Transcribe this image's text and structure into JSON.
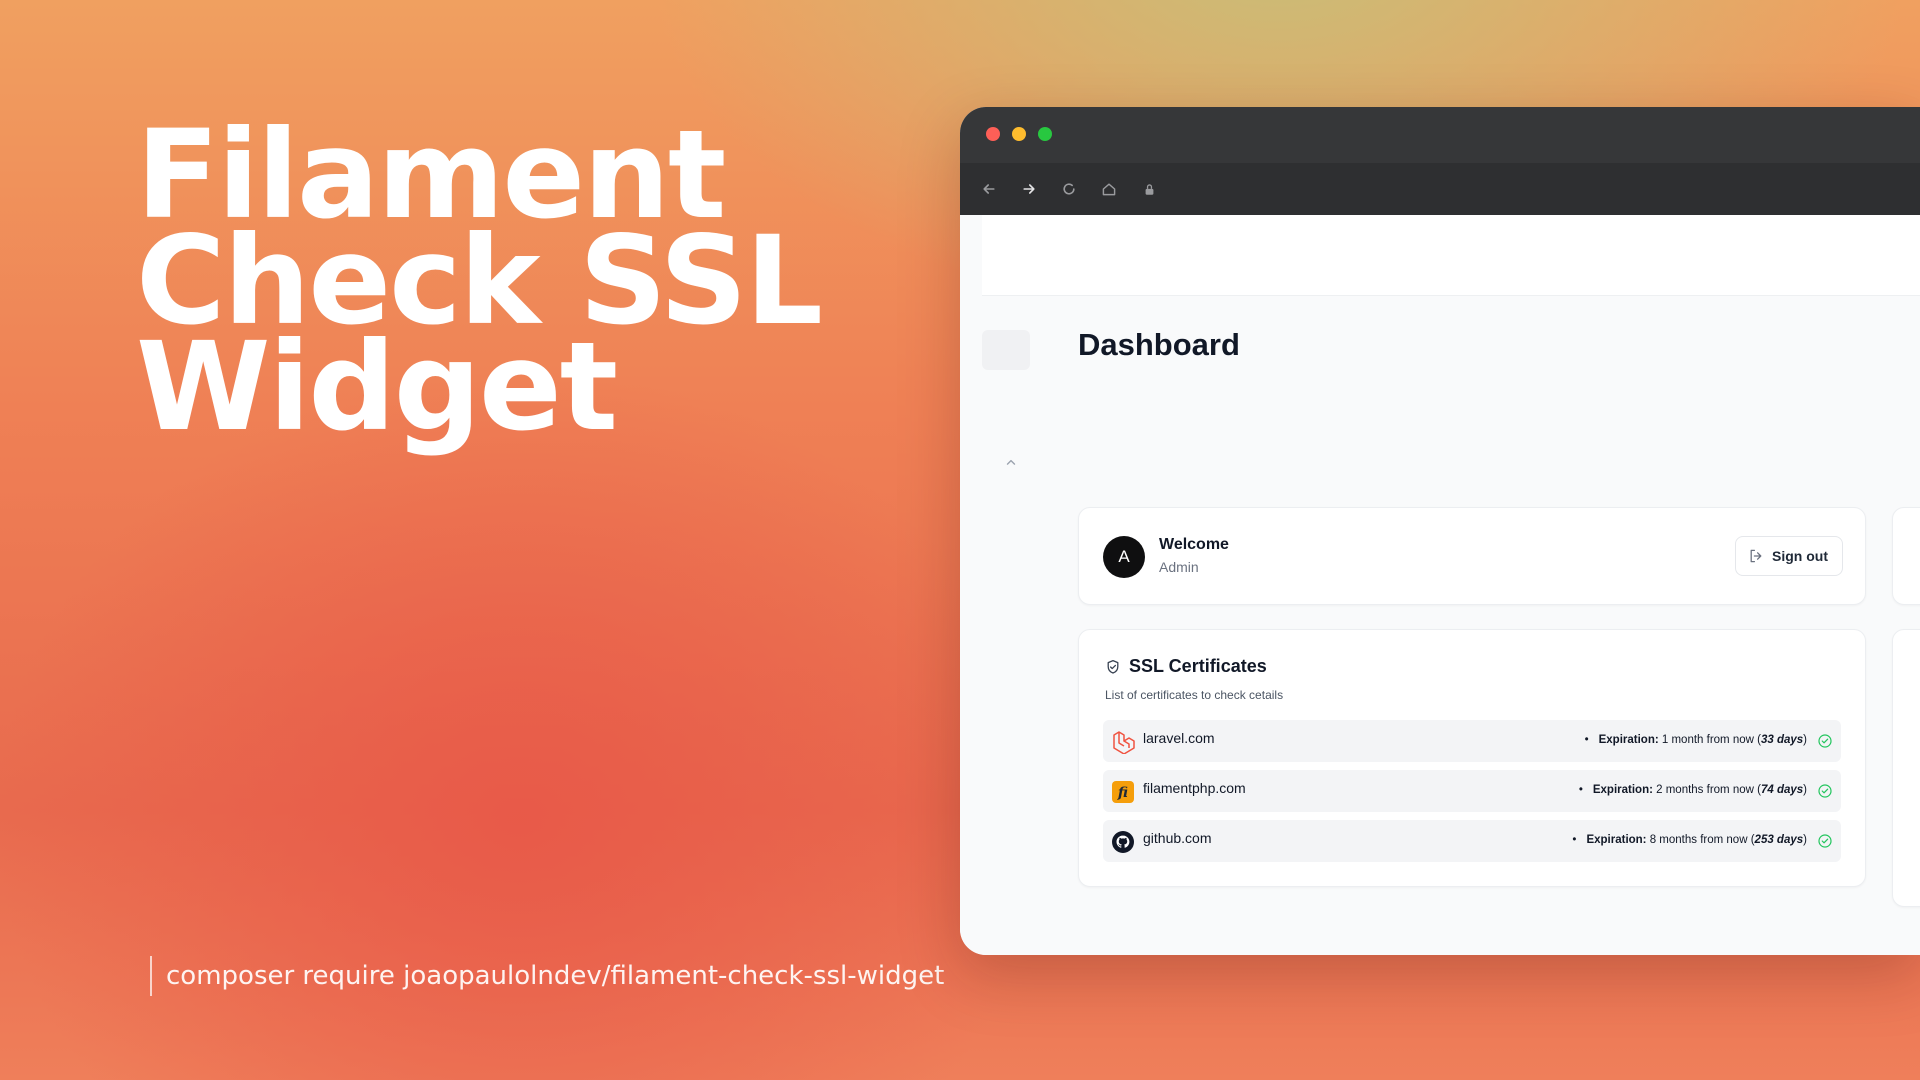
{
  "hero": {
    "title_lines": [
      "Filament",
      "Check SSL",
      "Widget"
    ],
    "command": "composer require joaopaulolndev/filament-check-ssl-widget"
  },
  "browser": {
    "icons": [
      "back-arrow-icon",
      "forward-arrow-icon",
      "reload-icon",
      "home-icon",
      "lock-icon"
    ]
  },
  "dashboard": {
    "title": "Dashboard",
    "welcome": {
      "avatar_initial": "A",
      "title": "Welcome",
      "role": "Admin",
      "signout_label": "Sign out"
    },
    "ssl": {
      "title": "SSL Certificates",
      "subtitle": "List of certificates to check cetails",
      "expiration_label": "Expiration:",
      "rows": [
        {
          "domain": "laravel.com",
          "relative": "1 month from now",
          "days": "33 days",
          "logo": "laravel-logo-icon",
          "status_color": "#22c55e"
        },
        {
          "domain": "filamentphp.com",
          "relative": "2 months from now",
          "days": "74 days",
          "logo": "filament-logo-icon",
          "status_color": "#22c55e"
        },
        {
          "domain": "github.com",
          "relative": "8 months from now",
          "days": "253 days",
          "logo": "github-logo-icon",
          "status_color": "#22c55e"
        }
      ]
    }
  },
  "colors": {
    "titlebar": "#363739",
    "dot_red": "#fe5f57",
    "dot_yellow": "#febc2e",
    "dot_green": "#28c840",
    "laravel": "#f05340",
    "filament": "#f59e0b"
  }
}
